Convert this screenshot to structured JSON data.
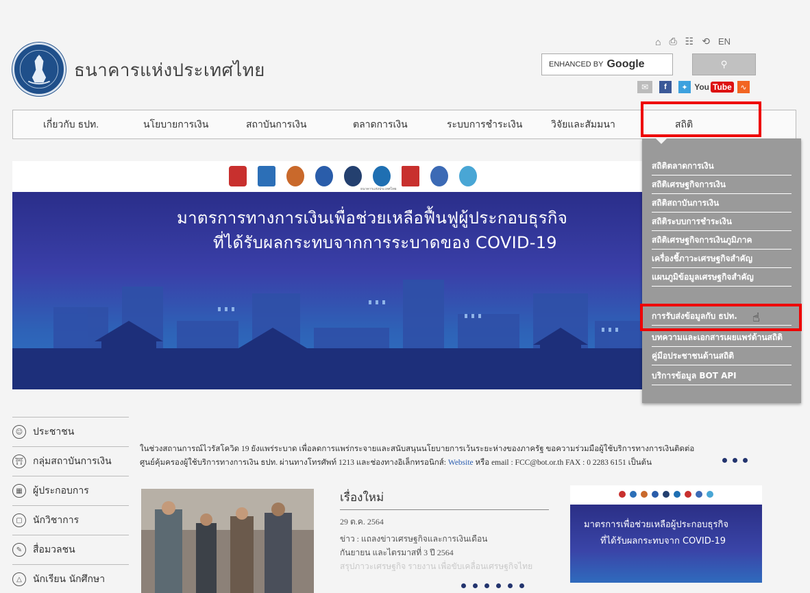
{
  "header": {
    "site_title": "ธนาคารแห่งประเทศไทย",
    "lang": "EN",
    "search_brand_prefix": "ENHANCED BY",
    "search_brand": "Google",
    "search_button_icon": "search-icon",
    "youtube_prefix": "You",
    "youtube_box": "Tube"
  },
  "nav": {
    "items": [
      {
        "label": "เกี่ยวกับ ธปท."
      },
      {
        "label": "นโยบายการเงิน"
      },
      {
        "label": "สถาบันการเงิน"
      },
      {
        "label": "ตลาดการเงิน"
      },
      {
        "label": "ระบบการชำระเงิน"
      },
      {
        "label": "วิจัยและสัมมนา"
      },
      {
        "label": "สถิติ"
      }
    ]
  },
  "dropdown": {
    "items": [
      {
        "label": "สถิติตลาดการเงิน"
      },
      {
        "label": "สถิติเศรษฐกิจการเงิน"
      },
      {
        "label": "สถิติสถาบันการเงิน"
      },
      {
        "label": "สถิติระบบการชำระเงิน"
      },
      {
        "label": "สถิติเศรษฐกิจการเงินภูมิภาค"
      },
      {
        "label": "เครื่องชี้ภาวะเศรษฐกิจสำคัญ"
      },
      {
        "label": "แผนภูมิข้อมูลเศรษฐกิจสำคัญ"
      },
      {
        "label": "การรับส่งข้อมูลกับ ธปท."
      },
      {
        "label": "บทความและเอกสารเผยแพร่ด้านสถิติ"
      },
      {
        "label": "คู่มือประชาชนด้านสถิติ"
      },
      {
        "label": "บริการข้อมูล BOT API"
      }
    ]
  },
  "banner": {
    "line1": "มาตรการทางการเงินเพื่อช่วยเหลือฟื้นฟูผู้ประกอบธุรกิจ",
    "line2": "ที่ได้รับผลกระทบจากการระบาดของ COVID-19",
    "logo_caption": "ธนาคารแห่งประเทศไทย"
  },
  "sidebar": {
    "items": [
      {
        "label": "ประชาชน"
      },
      {
        "label": "กลุ่มสถาบันการเงิน"
      },
      {
        "label": "ผู้ประกอบการ"
      },
      {
        "label": "นักวิชาการ"
      },
      {
        "label": "สื่อมวลชน"
      },
      {
        "label": "นักเรียน นักศึกษา"
      }
    ]
  },
  "notice": {
    "line1": "ในช่วงสถานการณ์ไวรัสโควิด 19 ยังแพร่ระบาด เพื่อลดการแพร่กระจายและสนับสนุนนโยบายการเว้นระยะห่างของภาครัฐ ขอความร่วมมือผู้ใช้บริการทางการเงินติดต่อ",
    "line2_pre": "ศูนย์คุ้มครองผู้ใช้บริการทางการเงิน ธปท. ผ่านทางโทรศัพท์ 1213 และช่องทางอิเล็กทรอนิกส์:",
    "website": "Website",
    "line2_post": "หรือ email : FCC@bot.or.th FAX : 0 2283 6151 เป็นต้น"
  },
  "news": {
    "title": "เรื่องใหม่",
    "date": "29 ต.ค. 2564",
    "text1": "ข่าว : แถลงข่าวเศรษฐกิจและการเงินเดือน",
    "text2": "กันยายน และไตรมาสที่ 3 ปี 2564",
    "text_fade": "สรุปภาวะเศรษฐกิจ รายงาน เพื่อขับเคลื่อนเศรษฐกิจไทย"
  },
  "promo": {
    "line1": "มาตรการเพื่อช่วยเหลือผู้ประกอบธุรกิจ",
    "line2": "ที่ได้รับผลกระทบจาก COVID-19"
  },
  "colors": {
    "highlight": "#e00000",
    "dropdown_bg": "#9a9a9a",
    "banner_blue": "#3a3fa8",
    "link": "#2a5db0"
  }
}
